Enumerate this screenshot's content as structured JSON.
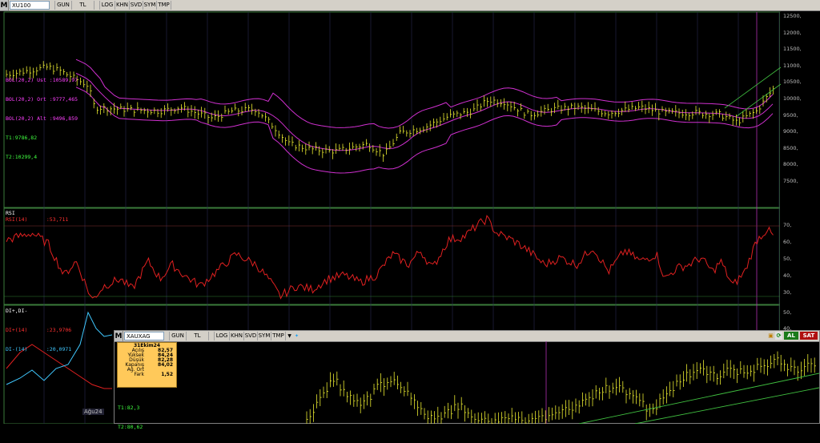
{
  "main": {
    "toolbar": {
      "logo": "M",
      "symbol": "XU100",
      "buttons": [
        "GUN",
        "TL",
        "LOG",
        "KHN",
        "SVD",
        "SYM",
        "TMP"
      ]
    },
    "price_legend": [
      {
        "label": "BOL(20,2) Ust",
        "value": ":10589,97",
        "color": "#ff40ff"
      },
      {
        "label": "BOL(20,2) Ort",
        "value": ":9777,465",
        "color": "#ff40ff"
      },
      {
        "label": "BOL(20,2) Alt",
        "value": ":9496,859",
        "color": "#ff40ff"
      },
      {
        "label": "T1:9786,82",
        "value": "",
        "color": "#40ff40"
      },
      {
        "label": "T2:10299,4",
        "value": "",
        "color": "#40ff40"
      }
    ],
    "price_axis": [
      "12500,",
      "12000,",
      "11500,",
      "11000,",
      "10500,",
      "10000,",
      "9500,",
      "9000,",
      "8500,",
      "8000,",
      "7500,"
    ],
    "rsi_title": "RSI",
    "rsi_legend": {
      "label": "RSI(14)",
      "value": ":53,711"
    },
    "rsi_axis": [
      "70,",
      "60,",
      "50,",
      "40,",
      "30,"
    ],
    "di_title": "DI+,DI-",
    "di_legend": [
      {
        "label": "DI+(14)",
        "value": ":23,9706",
        "color": "#ff3030"
      },
      {
        "label": "DI-(14)",
        "value": ":20,0971",
        "color": "#40c8ff"
      }
    ],
    "di_axis": [
      "50,",
      "40,"
    ],
    "date_label": "Ağu24",
    "colors": {
      "bars": "#e8e830",
      "bollinger": "#d030d0",
      "rsi": "#e02020",
      "trend": "#40c040"
    }
  },
  "sub": {
    "toolbar": {
      "logo": "M",
      "symbol": "XAUXAG",
      "buttons": [
        "GUN",
        "TL",
        "LOG",
        "KHN",
        "SVD",
        "SYM",
        "TMP"
      ]
    },
    "buy_label": "AL",
    "sell_label": "SAT",
    "info": {
      "date": "31Ekim24",
      "rows": [
        {
          "k": "Açılış",
          "v": "82,57"
        },
        {
          "k": "Yüksek",
          "v": "84,24"
        },
        {
          "k": "Düşük",
          "v": "82,28"
        },
        {
          "k": "Kapanış",
          "v": "84,02"
        },
        {
          "k": "Ağ. Ort",
          "v": ""
        },
        {
          "k": "Fark",
          "v": "1,52"
        }
      ]
    },
    "trend_labels": [
      "T1:82,3",
      "T2:80,62"
    ]
  }
}
